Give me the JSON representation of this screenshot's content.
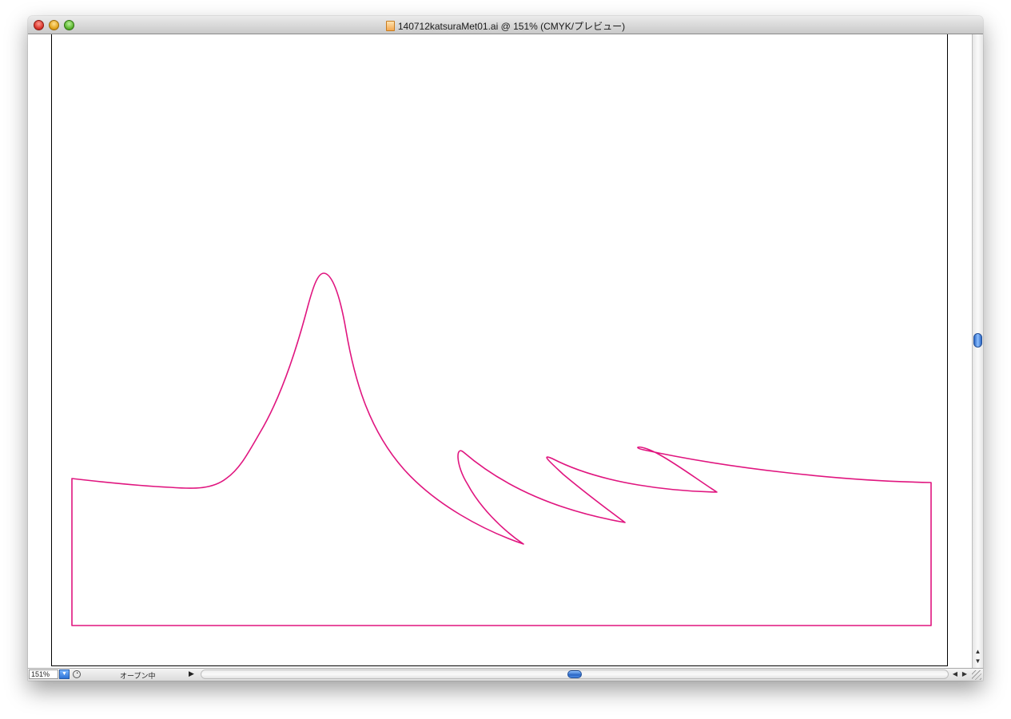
{
  "window": {
    "title": "140712katsuraMet01.ai @ 151% (CMYK/プレビュー)",
    "file_icon": "illustrator-document-icon"
  },
  "canvas": {
    "artwork_stroke_color": "#e0157f",
    "artboard_border_color": "#000000"
  },
  "statusbar": {
    "zoom_value": "151%",
    "status_text": "オープン中"
  },
  "icons": {
    "close": "close-button",
    "minimize": "minimize-button",
    "zoom": "zoom-button",
    "zoom_dropdown": "chevron-down-icon",
    "status_menu": "triangle-right-icon",
    "scroll_up": "arrow-up-icon",
    "scroll_down": "arrow-down-icon",
    "scroll_left": "arrow-left-icon",
    "scroll_right": "arrow-right-icon"
  }
}
